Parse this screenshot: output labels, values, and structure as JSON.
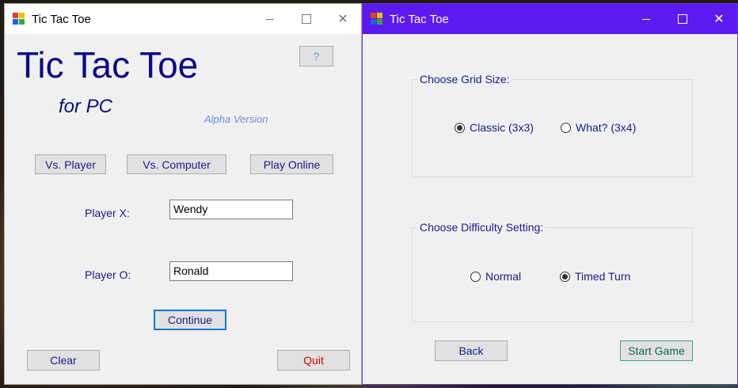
{
  "left_window": {
    "title": "Tic Tac Toe",
    "heading": "Tic Tac Toe",
    "subheading": "for PC",
    "version": "Alpha Version",
    "help_label": "?",
    "mode_buttons": [
      "Vs. Player",
      "Vs. Computer",
      "Play Online"
    ],
    "player_x_label": "Player X:",
    "player_x_value": "Wendy",
    "player_o_label": "Player O:",
    "player_o_value": "Ronald",
    "continue_label": "Continue",
    "clear_label": "Clear",
    "quit_label": "Quit"
  },
  "right_window": {
    "title": "Tic Tac Toe",
    "grid_group_title": "Choose Grid Size:",
    "grid_options": [
      {
        "label": "Classic (3x3)",
        "checked": true
      },
      {
        "label": "What? (3x4)",
        "checked": false
      }
    ],
    "difficulty_group_title": "Choose Difficulty Setting:",
    "difficulty_options": [
      {
        "label": "Normal",
        "checked": false
      },
      {
        "label": "Timed Turn",
        "checked": true
      }
    ],
    "back_label": "Back",
    "start_label": "Start Game"
  },
  "colors": {
    "label_text": "#1a1a8c",
    "heading": "#0a0a8a",
    "version": "#6f8fd8",
    "quit_text": "#e00000",
    "start_text": "#0a6a4a",
    "active_titlebar": "#5b1bf0",
    "focus_border": "#0078d7"
  },
  "icons": [
    "app-icon",
    "minimize-icon",
    "maximize-icon",
    "close-icon"
  ]
}
